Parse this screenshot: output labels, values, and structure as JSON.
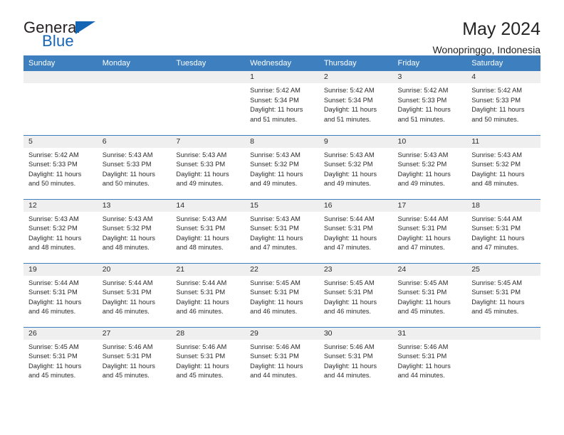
{
  "brand": {
    "word_general": "General",
    "word_blue": "Blue"
  },
  "header": {
    "title": "May 2024",
    "subtitle": "Wonopringgo, Indonesia"
  },
  "calendar": {
    "weekday_headers": [
      "Sunday",
      "Monday",
      "Tuesday",
      "Wednesday",
      "Thursday",
      "Friday",
      "Saturday"
    ],
    "labels": {
      "sunrise": "Sunrise:",
      "sunset": "Sunset:",
      "daylight": "Daylight:"
    },
    "weeks": [
      [
        {
          "empty": true
        },
        {
          "empty": true
        },
        {
          "empty": true
        },
        {
          "day": "1",
          "sunrise": "Sunrise: 5:42 AM",
          "sunset": "Sunset: 5:34 PM",
          "daylight": "Daylight: 11 hours and 51 minutes."
        },
        {
          "day": "2",
          "sunrise": "Sunrise: 5:42 AM",
          "sunset": "Sunset: 5:34 PM",
          "daylight": "Daylight: 11 hours and 51 minutes."
        },
        {
          "day": "3",
          "sunrise": "Sunrise: 5:42 AM",
          "sunset": "Sunset: 5:33 PM",
          "daylight": "Daylight: 11 hours and 51 minutes."
        },
        {
          "day": "4",
          "sunrise": "Sunrise: 5:42 AM",
          "sunset": "Sunset: 5:33 PM",
          "daylight": "Daylight: 11 hours and 50 minutes."
        }
      ],
      [
        {
          "day": "5",
          "sunrise": "Sunrise: 5:42 AM",
          "sunset": "Sunset: 5:33 PM",
          "daylight": "Daylight: 11 hours and 50 minutes."
        },
        {
          "day": "6",
          "sunrise": "Sunrise: 5:43 AM",
          "sunset": "Sunset: 5:33 PM",
          "daylight": "Daylight: 11 hours and 50 minutes."
        },
        {
          "day": "7",
          "sunrise": "Sunrise: 5:43 AM",
          "sunset": "Sunset: 5:33 PM",
          "daylight": "Daylight: 11 hours and 49 minutes."
        },
        {
          "day": "8",
          "sunrise": "Sunrise: 5:43 AM",
          "sunset": "Sunset: 5:32 PM",
          "daylight": "Daylight: 11 hours and 49 minutes."
        },
        {
          "day": "9",
          "sunrise": "Sunrise: 5:43 AM",
          "sunset": "Sunset: 5:32 PM",
          "daylight": "Daylight: 11 hours and 49 minutes."
        },
        {
          "day": "10",
          "sunrise": "Sunrise: 5:43 AM",
          "sunset": "Sunset: 5:32 PM",
          "daylight": "Daylight: 11 hours and 49 minutes."
        },
        {
          "day": "11",
          "sunrise": "Sunrise: 5:43 AM",
          "sunset": "Sunset: 5:32 PM",
          "daylight": "Daylight: 11 hours and 48 minutes."
        }
      ],
      [
        {
          "day": "12",
          "sunrise": "Sunrise: 5:43 AM",
          "sunset": "Sunset: 5:32 PM",
          "daylight": "Daylight: 11 hours and 48 minutes."
        },
        {
          "day": "13",
          "sunrise": "Sunrise: 5:43 AM",
          "sunset": "Sunset: 5:32 PM",
          "daylight": "Daylight: 11 hours and 48 minutes."
        },
        {
          "day": "14",
          "sunrise": "Sunrise: 5:43 AM",
          "sunset": "Sunset: 5:31 PM",
          "daylight": "Daylight: 11 hours and 48 minutes."
        },
        {
          "day": "15",
          "sunrise": "Sunrise: 5:43 AM",
          "sunset": "Sunset: 5:31 PM",
          "daylight": "Daylight: 11 hours and 47 minutes."
        },
        {
          "day": "16",
          "sunrise": "Sunrise: 5:44 AM",
          "sunset": "Sunset: 5:31 PM",
          "daylight": "Daylight: 11 hours and 47 minutes."
        },
        {
          "day": "17",
          "sunrise": "Sunrise: 5:44 AM",
          "sunset": "Sunset: 5:31 PM",
          "daylight": "Daylight: 11 hours and 47 minutes."
        },
        {
          "day": "18",
          "sunrise": "Sunrise: 5:44 AM",
          "sunset": "Sunset: 5:31 PM",
          "daylight": "Daylight: 11 hours and 47 minutes."
        }
      ],
      [
        {
          "day": "19",
          "sunrise": "Sunrise: 5:44 AM",
          "sunset": "Sunset: 5:31 PM",
          "daylight": "Daylight: 11 hours and 46 minutes."
        },
        {
          "day": "20",
          "sunrise": "Sunrise: 5:44 AM",
          "sunset": "Sunset: 5:31 PM",
          "daylight": "Daylight: 11 hours and 46 minutes."
        },
        {
          "day": "21",
          "sunrise": "Sunrise: 5:44 AM",
          "sunset": "Sunset: 5:31 PM",
          "daylight": "Daylight: 11 hours and 46 minutes."
        },
        {
          "day": "22",
          "sunrise": "Sunrise: 5:45 AM",
          "sunset": "Sunset: 5:31 PM",
          "daylight": "Daylight: 11 hours and 46 minutes."
        },
        {
          "day": "23",
          "sunrise": "Sunrise: 5:45 AM",
          "sunset": "Sunset: 5:31 PM",
          "daylight": "Daylight: 11 hours and 46 minutes."
        },
        {
          "day": "24",
          "sunrise": "Sunrise: 5:45 AM",
          "sunset": "Sunset: 5:31 PM",
          "daylight": "Daylight: 11 hours and 45 minutes."
        },
        {
          "day": "25",
          "sunrise": "Sunrise: 5:45 AM",
          "sunset": "Sunset: 5:31 PM",
          "daylight": "Daylight: 11 hours and 45 minutes."
        }
      ],
      [
        {
          "day": "26",
          "sunrise": "Sunrise: 5:45 AM",
          "sunset": "Sunset: 5:31 PM",
          "daylight": "Daylight: 11 hours and 45 minutes."
        },
        {
          "day": "27",
          "sunrise": "Sunrise: 5:46 AM",
          "sunset": "Sunset: 5:31 PM",
          "daylight": "Daylight: 11 hours and 45 minutes."
        },
        {
          "day": "28",
          "sunrise": "Sunrise: 5:46 AM",
          "sunset": "Sunset: 5:31 PM",
          "daylight": "Daylight: 11 hours and 45 minutes."
        },
        {
          "day": "29",
          "sunrise": "Sunrise: 5:46 AM",
          "sunset": "Sunset: 5:31 PM",
          "daylight": "Daylight: 11 hours and 44 minutes."
        },
        {
          "day": "30",
          "sunrise": "Sunrise: 5:46 AM",
          "sunset": "Sunset: 5:31 PM",
          "daylight": "Daylight: 11 hours and 44 minutes."
        },
        {
          "day": "31",
          "sunrise": "Sunrise: 5:46 AM",
          "sunset": "Sunset: 5:31 PM",
          "daylight": "Daylight: 11 hours and 44 minutes."
        },
        {
          "empty": true
        }
      ]
    ]
  },
  "colors": {
    "header_blue": "#3d7fbf",
    "logo_blue": "#1565b5",
    "daynum_band": "#efefef",
    "text": "#2b2b2b"
  }
}
